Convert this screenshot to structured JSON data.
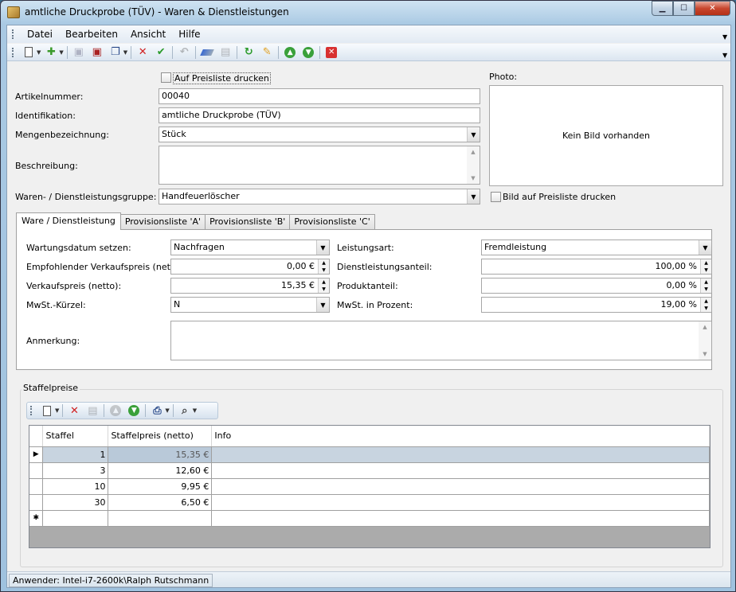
{
  "window": {
    "title": "amtliche Druckprobe (TÜV) - Waren & Dienstleistungen",
    "controls": [
      "minimize-icon",
      "maximize-icon",
      "close-icon"
    ]
  },
  "menu": [
    "Datei",
    "Bearbeiten",
    "Ansicht",
    "Hilfe"
  ],
  "toolbar": {
    "icons": [
      "new-icon",
      "add-icon",
      "save-disabled-icon",
      "save-close-icon",
      "copy-icon",
      "delete-icon",
      "confirm-icon",
      "undo-icon",
      "eraser-icon",
      "report-icon",
      "refresh-icon",
      "edit-icon",
      "up-icon",
      "down-icon",
      "close-icon"
    ]
  },
  "form": {
    "auf_preisliste_label": "Auf Preisliste drucken",
    "artikelnummer_label": "Artikelnummer:",
    "artikelnummer": "00040",
    "identifikation_label": "Identifikation:",
    "identifikation": "amtliche Druckprobe (TÜV)",
    "mengen_label": "Mengenbezeichnung:",
    "mengen": "Stück",
    "beschreibung_label": "Beschreibung:",
    "beschreibung": "",
    "gruppe_label": "Waren- / Dienstleistungsgruppe:",
    "gruppe": "Handfeuerlöscher",
    "photo_label": "Photo:",
    "photo_placeholder": "Kein Bild vorhanden",
    "bild_preisliste_label": "Bild auf Preisliste drucken"
  },
  "tabs": [
    "Ware / Dienstleistung",
    "Provisionsliste 'A'",
    "Provisionsliste 'B'",
    "Provisionsliste 'C'"
  ],
  "tabpanel": {
    "wartung_label": "Wartungsdatum setzen:",
    "wartung": "Nachfragen",
    "ek_label": "Empfohlender Verkaufspreis (netto):",
    "ek": "0,00 €",
    "vk_label": "Verkaufspreis (netto):",
    "vk": "15,35 €",
    "mwst_label": "MwSt.-Kürzel:",
    "mwst": "N",
    "leistung_label": "Leistungsart:",
    "leistung": "Fremdleistung",
    "dienst_label": "Dienstleistungsanteil:",
    "dienst": "100,00 %",
    "produkt_label": "Produktanteil:",
    "produkt": "0,00 %",
    "mwst_proz_label": "MwSt. in Prozent:",
    "mwst_proz": "19,00 %",
    "anmerkung_label": "Anmerkung:",
    "anmerkung": ""
  },
  "staffel": {
    "title": "Staffelpreise",
    "columns": [
      "Staffel",
      "Staffelpreis (netto)",
      "Info"
    ],
    "rows": [
      {
        "staffel": "1",
        "preis": "15,35 €",
        "info": ""
      },
      {
        "staffel": "3",
        "preis": "12,60 €",
        "info": ""
      },
      {
        "staffel": "10",
        "preis": "9,95 €",
        "info": ""
      },
      {
        "staffel": "30",
        "preis": "6,50 €",
        "info": ""
      }
    ],
    "current_marker": "▶",
    "new_marker": "✱"
  },
  "status": {
    "user": "Anwender: Intel-i7-2600k\\Ralph Rutschmann"
  }
}
